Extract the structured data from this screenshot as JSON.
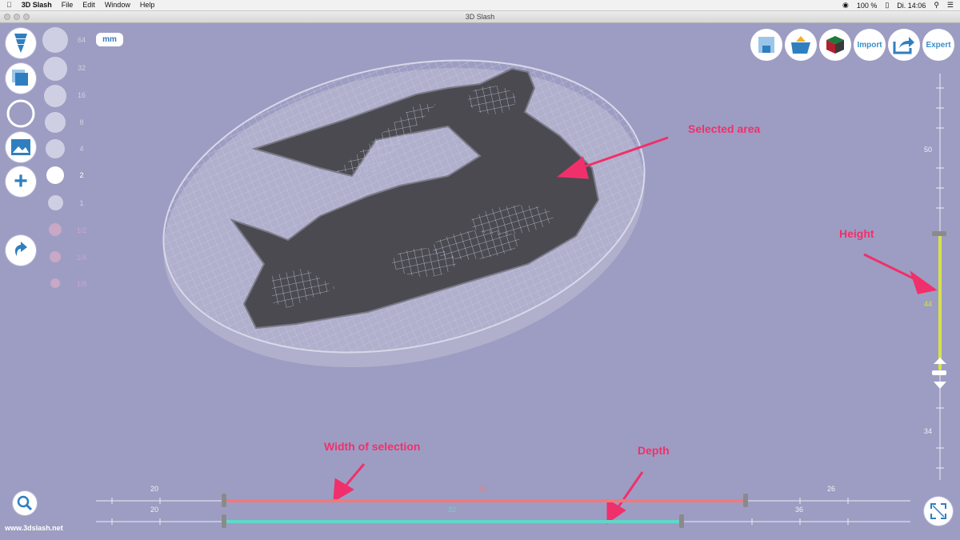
{
  "menubar": {
    "apple_icon": "apple-icon",
    "app_name": "3D Slash",
    "items": [
      "File",
      "Edit",
      "Window",
      "Help"
    ],
    "battery": "100 %",
    "clock": "Di. 14:06"
  },
  "window": {
    "title": "3D Slash"
  },
  "tools": {
    "unit": "mm"
  },
  "size_labels": [
    "64",
    "32",
    "16",
    "8",
    "4",
    "2",
    "1",
    "1/2",
    "1/4",
    "1/8"
  ],
  "toolbar": {
    "import_label": "Import",
    "expert_label": "Expert"
  },
  "annotations": {
    "selected_area": "Selected area",
    "height": "Height",
    "width_of_selection": "Width of selection",
    "depth": "Depth"
  },
  "height_slider": {
    "ticks": [
      "50",
      "44",
      "34"
    ]
  },
  "width_slider": {
    "left": "20",
    "value": "32",
    "right": "26"
  },
  "depth_slider": {
    "left": "20",
    "value": "32",
    "right": "36"
  },
  "footer": {
    "url": "www.3dslash.net"
  }
}
